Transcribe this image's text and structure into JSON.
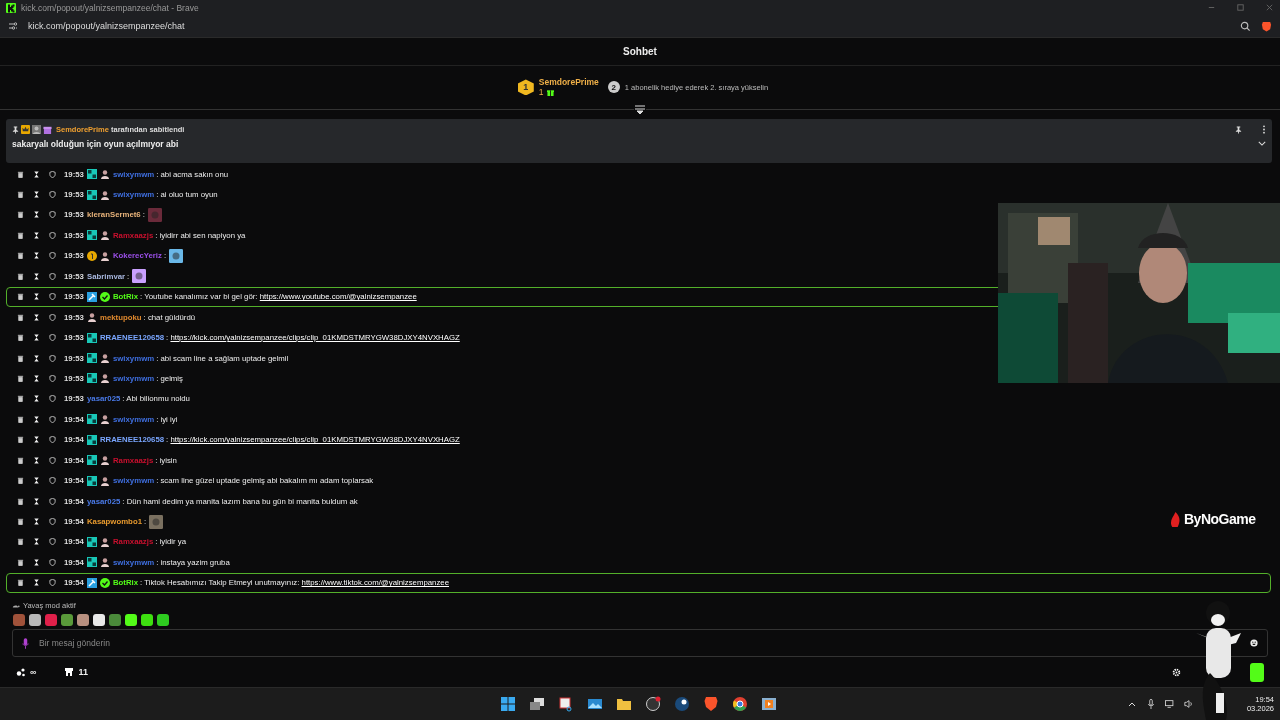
{
  "window": {
    "title": "kick.com/popout/yalnizsempanzee/chat - Brave"
  },
  "address_bar": {
    "url": "kick.com/popout/yalnizsempanzee/chat"
  },
  "chat_header": {
    "title": "Sohbet"
  },
  "leaderboard": {
    "rank": "1",
    "name": "SemdorePrime",
    "count": "1",
    "hint_rank": "2",
    "hint": "1 abonelik hediye ederek 2. sıraya yükselin"
  },
  "pinned": {
    "by": "SemdorePrime",
    "by_suffix": " tarafından sabitlendi",
    "message": "sakaryalı olduğun için oyun açılmıyor abi"
  },
  "messages": [
    {
      "time": "19:53",
      "badges": [
        {
          "kind": "sub"
        },
        {
          "kind": "avatar"
        }
      ],
      "user": "swixymwm",
      "color": "#3f6fe0",
      "text": ": abi acma sakın onu",
      "highlighted": false
    },
    {
      "time": "19:53",
      "badges": [
        {
          "kind": "sub"
        },
        {
          "kind": "avatar"
        }
      ],
      "user": "swixymwm",
      "color": "#3f6fe0",
      "text": ": ai oluo tum oyun",
      "highlighted": false
    },
    {
      "time": "19:53",
      "user": "kleranSermet6",
      "color": "#e8b37a",
      "text": ":",
      "emote": {
        "kind": "dark"
      },
      "highlighted": false
    },
    {
      "time": "19:53",
      "badges": [
        {
          "kind": "sub"
        },
        {
          "kind": "avatar"
        }
      ],
      "user": "Ramxaazjs",
      "color": "#c8102e",
      "text": ": iyidirr abi sen napiyon ya",
      "highlighted": false
    },
    {
      "time": "19:53",
      "badges": [
        {
          "kind": "gift"
        },
        {
          "kind": "avatar"
        }
      ],
      "user": "KokerecYeriz",
      "color": "#9b4fe8",
      "text": ":",
      "emote": {
        "kind": "screen"
      },
      "highlighted": false
    },
    {
      "time": "19:53",
      "user": "Sabrimvar",
      "color": "#a9b8e0",
      "text": ":",
      "emote": {
        "kind": "wand"
      },
      "highlighted": false
    },
    {
      "time": "19:53",
      "badges": [
        {
          "kind": "bot"
        },
        {
          "kind": "verified"
        }
      ],
      "user": "BotRix",
      "color": "#53fc18",
      "text": ": Youtube kanalımız var bi gel gör: ",
      "link": "https://www.youtube.com/@yalnizsempanzee",
      "highlighted": true
    },
    {
      "time": "19:53",
      "badges": [
        {
          "kind": "avatar"
        }
      ],
      "user": "mektupoku",
      "color": "#e0892e",
      "text": ": chat güldürdü",
      "highlighted": false
    },
    {
      "time": "19:53",
      "badges": [
        {
          "kind": "sub"
        }
      ],
      "user": "RRAENEE120658",
      "color": "#7aa6ff",
      "text": ": ",
      "link": "https://kick.com/yalnizsempanzee/clips/clip_01KMDSTMRYGW38DJXY4NVXHAGZ",
      "highlighted": false
    },
    {
      "time": "19:53",
      "badges": [
        {
          "kind": "sub"
        },
        {
          "kind": "avatar"
        }
      ],
      "user": "swixymwm",
      "color": "#3f6fe0",
      "text": ": abi scam line a sağlam uptade gelmil",
      "highlighted": false
    },
    {
      "time": "19:53",
      "badges": [
        {
          "kind": "sub"
        },
        {
          "kind": "avatar"
        }
      ],
      "user": "swixymwm",
      "color": "#3f6fe0",
      "text": ": gelmiş",
      "highlighted": false
    },
    {
      "time": "19:53",
      "user": "yasar025",
      "color": "#4a7ae8",
      "text": ": Abi bilionmu noldu",
      "highlighted": false
    },
    {
      "time": "19:54",
      "badges": [
        {
          "kind": "sub"
        },
        {
          "kind": "avatar"
        }
      ],
      "user": "swixymwm",
      "color": "#3f6fe0",
      "text": ": iyi iyi",
      "highlighted": false
    },
    {
      "time": "19:54",
      "badges": [
        {
          "kind": "sub"
        }
      ],
      "user": "RRAENEE120658",
      "color": "#7aa6ff",
      "text": ": ",
      "link": "https://kick.com/yalnizsempanzee/clips/clip_01KMDSTMRYGW38DJXY4NVXHAGZ",
      "highlighted": false
    },
    {
      "time": "19:54",
      "badges": [
        {
          "kind": "sub"
        },
        {
          "kind": "avatar"
        }
      ],
      "user": "Ramxaazjs",
      "color": "#c8102e",
      "text": ": iyisin",
      "highlighted": false
    },
    {
      "time": "19:54",
      "badges": [
        {
          "kind": "sub"
        },
        {
          "kind": "avatar"
        }
      ],
      "user": "swixymwm",
      "color": "#3f6fe0",
      "text": ": scam line güzel uptade gelmiş abi bakalım mı adam toplarsak",
      "highlighted": false
    },
    {
      "time": "19:54",
      "user": "yasar025",
      "color": "#4a7ae8",
      "text": ": Dün hami dedim ya manita lazım bana bu gün bi manita buldum ak",
      "highlighted": false
    },
    {
      "time": "19:54",
      "user": "Kasapwombo1",
      "color": "#e89a2e",
      "text": ":",
      "highlighted": false
    },
    {
      "time": "19:54",
      "badges": [
        {
          "kind": "sub"
        },
        {
          "kind": "avatar"
        }
      ],
      "user": "Ramxaazjs",
      "color": "#c8102e",
      "text": ": iyidir ya",
      "highlighted": false
    },
    {
      "time": "19:54",
      "badges": [
        {
          "kind": "sub"
        },
        {
          "kind": "avatar"
        }
      ],
      "user": "swixymwm",
      "color": "#3f6fe0",
      "text": ": instaya yazim gruba",
      "highlighted": false
    },
    {
      "time": "19:54",
      "badges": [
        {
          "kind": "bot"
        },
        {
          "kind": "verified"
        }
      ],
      "user": "BotRix",
      "color": "#53fc18",
      "text": ": Tiktok Hesabımızı Takip Etmeyi unutmayınız: ",
      "link": "https://www.tiktok.com/@yalnizsempanzee",
      "highlighted": true
    }
  ],
  "slow_mode": {
    "label": "Yavaş mod aktif"
  },
  "emote_bar": {
    "emotes": [
      {
        "color": "#a0523a"
      },
      {
        "color": "#b8b8b8"
      },
      {
        "color": "#e0204a"
      },
      {
        "color": "#5a9a3a"
      },
      {
        "color": "#b89080"
      },
      {
        "color": "#e8e8e8"
      },
      {
        "color": "#4a8a3a"
      },
      {
        "color": "#53fc18"
      },
      {
        "color": "#3ee010"
      },
      {
        "color": "#2ecc20"
      }
    ]
  },
  "message_input": {
    "placeholder": "Bir mesaj gönderin"
  },
  "footer": {
    "points": "∞",
    "store_count": "11"
  },
  "stream_overlay": {
    "logo": "ByNoGame"
  },
  "taskbar": {
    "time": "19:54",
    "date": "03.2026"
  }
}
